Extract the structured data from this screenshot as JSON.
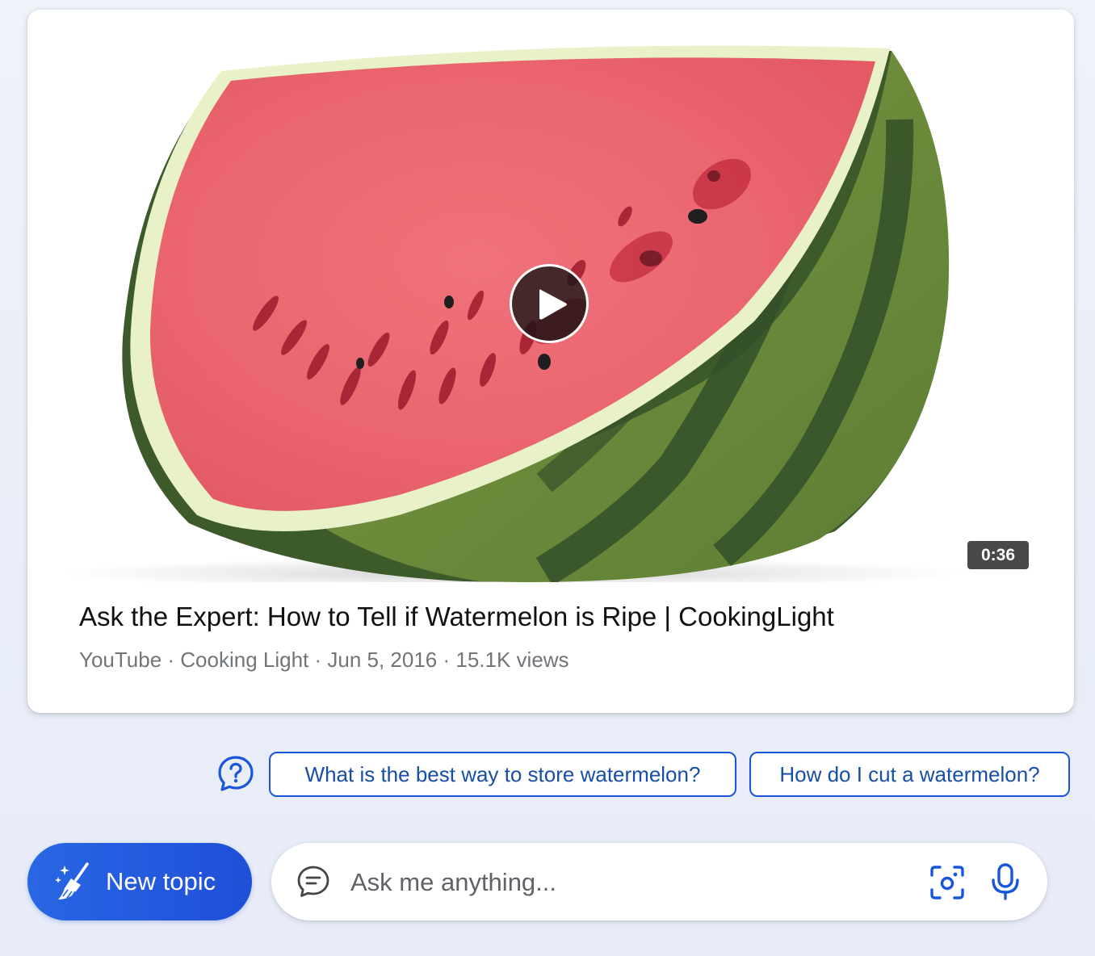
{
  "video": {
    "duration": "0:36",
    "title": "Ask the Expert: How to Tell if Watermelon is Ripe | CookingLight",
    "meta": "YouTube · Cooking Light · Jun 5, 2016 · 15.1K views"
  },
  "suggestions": [
    {
      "label": "What is the best way to store watermelon?"
    },
    {
      "label": "How do I cut a watermelon?"
    }
  ],
  "bottom_bar": {
    "new_topic_label": "New topic",
    "input_placeholder": "Ask me anything...",
    "input_value": ""
  },
  "icons": {
    "help": "question-chat-icon",
    "broom": "broom-icon",
    "chat": "chat-icon",
    "visual_search": "visual-search-icon",
    "mic": "microphone-icon",
    "play": "play-icon"
  },
  "colors": {
    "accent": "#1f4fd8",
    "chip_border": "#1a56db",
    "chip_text": "#174ea6",
    "page_background": "#eef2f9"
  }
}
